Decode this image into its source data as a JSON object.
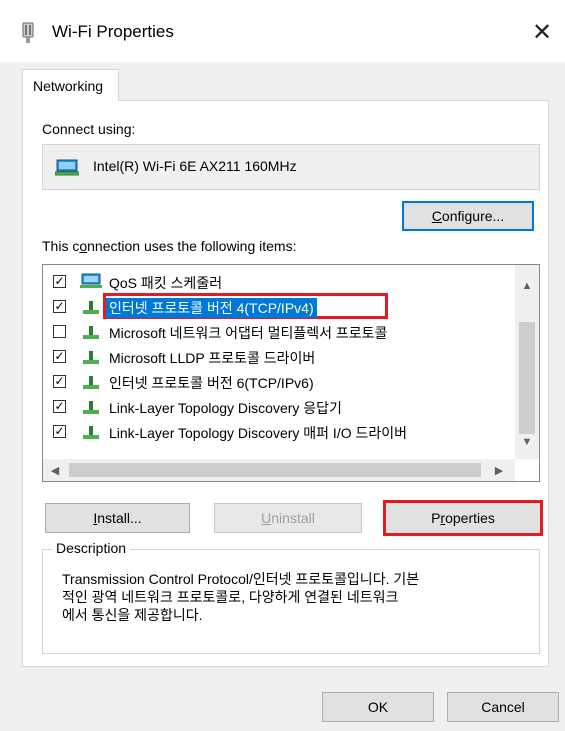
{
  "window": {
    "title": "Wi-Fi Properties",
    "close_label": "✕"
  },
  "tabs": [
    {
      "label": "Networking"
    }
  ],
  "connect_using": {
    "label": "Connect using:",
    "adapter_name": "Intel(R) Wi-Fi 6E AX211 160MHz",
    "configure_button": {
      "pre": "",
      "accel": "C",
      "post": "onfigure..."
    }
  },
  "items_section": {
    "label_pre": "This c",
    "label_accel": "o",
    "label_post": "nnection uses the following items:",
    "items": [
      {
        "label": "QoS 패킷 스케줄러",
        "checked": true,
        "icon": "qos-scheduler-icon"
      },
      {
        "label": "인터넷 프로토콜 버전 4(TCP/IPv4)",
        "checked": true,
        "selected": true,
        "icon": "protocol-icon"
      },
      {
        "label": "Microsoft 네트워크 어댑터 멀티플렉서 프로토콜",
        "checked": false,
        "icon": "protocol-icon"
      },
      {
        "label": "Microsoft LLDP 프로토콜 드라이버",
        "checked": true,
        "icon": "protocol-icon"
      },
      {
        "label": "인터넷 프로토콜 버전 6(TCP/IPv6)",
        "checked": true,
        "icon": "protocol-icon"
      },
      {
        "label": "Link-Layer Topology Discovery 응답기",
        "checked": true,
        "icon": "protocol-icon"
      },
      {
        "label": "Link-Layer Topology Discovery 매퍼 I/O 드라이버",
        "checked": true,
        "icon": "protocol-icon"
      }
    ]
  },
  "buttons": {
    "install": {
      "pre": "",
      "accel": "I",
      "post": "nstall..."
    },
    "uninstall": {
      "pre": "",
      "accel": "U",
      "post": "ninstall"
    },
    "properties": {
      "pre": "P",
      "accel": "r",
      "post": "operties"
    },
    "ok": "OK",
    "cancel": "Cancel"
  },
  "description": {
    "legend": "Description",
    "lines": [
      "Transmission Control Protocol/인터넷 프로토콜입니다. 기본",
      "적인 광역 네트워크 프로토콜로, 다양하게 연결된 네트워크",
      "에서 통신을 제공합니다."
    ]
  },
  "colors": {
    "selection": "#0078d7",
    "highlight_box": "#e31c23",
    "dialog_bg": "#f0f0f0"
  }
}
